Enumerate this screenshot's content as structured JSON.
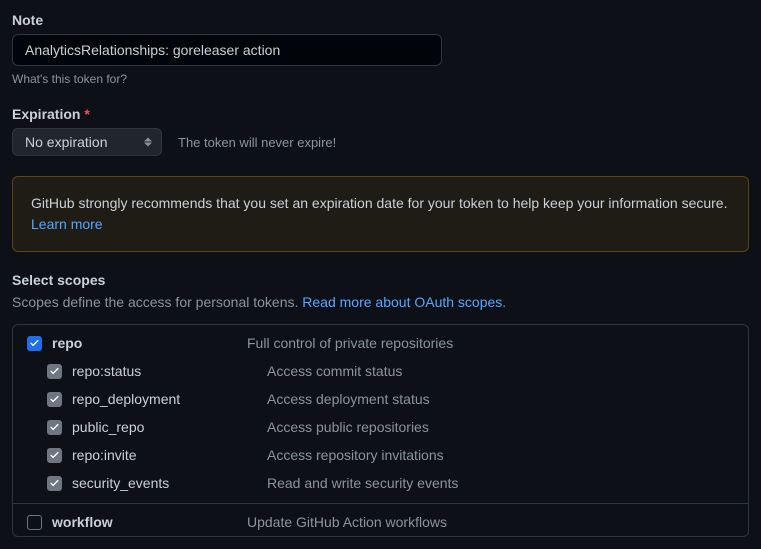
{
  "note": {
    "label": "Note",
    "value": "AnalyticsRelationships: goreleaser action",
    "help": "What's this token for?"
  },
  "expiration": {
    "label": "Expiration",
    "selected": "No expiration",
    "info": "The token will never expire!"
  },
  "alert": {
    "text": "GitHub strongly recommends that you set an expiration date for your token to help keep your information secure.",
    "link": "Learn more"
  },
  "scopes": {
    "heading": "Select scopes",
    "desc_prefix": "Scopes define the access for personal tokens. ",
    "desc_link": "Read more about OAuth scopes",
    "desc_suffix": ".",
    "items": [
      {
        "name": "repo",
        "desc": "Full control of private repositories"
      },
      {
        "name": "repo:status",
        "desc": "Access commit status"
      },
      {
        "name": "repo_deployment",
        "desc": "Access deployment status"
      },
      {
        "name": "public_repo",
        "desc": "Access public repositories"
      },
      {
        "name": "repo:invite",
        "desc": "Access repository invitations"
      },
      {
        "name": "security_events",
        "desc": "Read and write security events"
      },
      {
        "name": "workflow",
        "desc": "Update GitHub Action workflows"
      }
    ]
  }
}
